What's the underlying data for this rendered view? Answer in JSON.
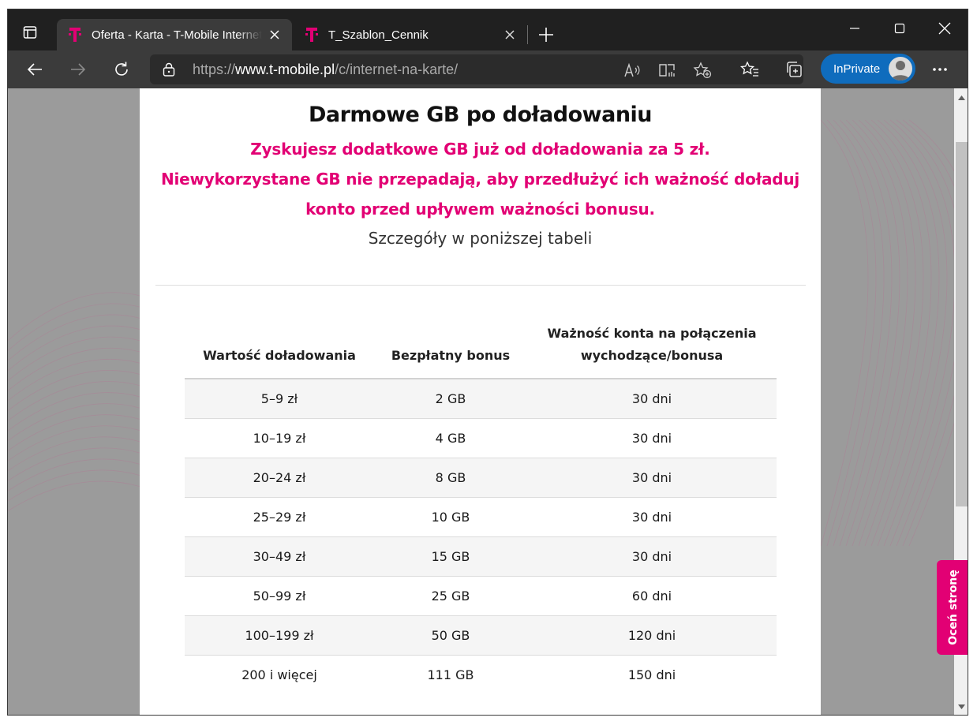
{
  "browser": {
    "tabs": [
      {
        "title": "Oferta - Karta - T-Mobile Internet",
        "active": true,
        "icon": "t-mobile-logo-icon"
      },
      {
        "title": "T_Szablon_Cennik",
        "active": false,
        "icon": "t-mobile-logo-icon"
      }
    ],
    "address": {
      "prefix": "https://",
      "host": "www.t-mobile.pl",
      "path": "/c/internet-na-karte/"
    },
    "inprivate_label": "InPrivate",
    "colors": {
      "chrome_dark": "#202020",
      "toolbar": "#3b3b3b",
      "inprivate": "#0f6cbd"
    }
  },
  "page": {
    "heading": "Darmowe GB po doładowaniu",
    "subtitle_lines": [
      "Zyskujesz dodatkowe GB już od doładowania za 5 zł.",
      "Niewykorzystane GB nie przepadają, aby przedłużyć ich ważność doładuj",
      "konto przed upływem ważności bonusu."
    ],
    "details": "Szczegóły w poniższej tabeli",
    "table": {
      "headers": [
        "Wartość doładowania",
        "Bezpłatny bonus",
        "Ważność konta na połączenia",
        "wychodzące/bonusa"
      ],
      "rows": [
        [
          "5–9 zł",
          "2 GB",
          "30 dni"
        ],
        [
          "10–19 zł",
          "4 GB",
          "30 dni"
        ],
        [
          "20–24 zł",
          "8 GB",
          "30 dni"
        ],
        [
          "25–29 zł",
          "10 GB",
          "30 dni"
        ],
        [
          "30–49 zł",
          "15 GB",
          "30 dni"
        ],
        [
          "50–99 zł",
          "25 GB",
          "60 dni"
        ],
        [
          "100–199 zł",
          "50 GB",
          "120 dni"
        ],
        [
          "200 i więcej",
          "111 GB",
          "150 dni"
        ]
      ]
    },
    "feedback_label": "Oceń stronę",
    "colors": {
      "brand_magenta": "#e20074"
    }
  }
}
